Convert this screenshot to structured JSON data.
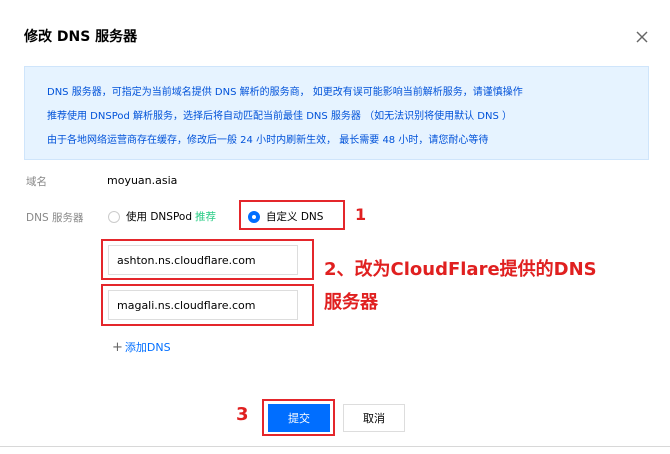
{
  "dialog": {
    "title": "修改 DNS 服务器"
  },
  "notice": {
    "lines": [
      "DNS 服务器，可指定为当前域名提供 DNS 解析的服务商， 如更改有误可能影响当前解析服务，请谨慎操作",
      "推荐使用 DNSPod 解析服务，选择后将自动匹配当前最佳 DNS 服务器 （如无法识别将使用默认 DNS ）",
      "由于各地网络运营商存在缓存，修改后一般 24 小时内刷新生效， 最长需要 48 小时，请您耐心等待"
    ]
  },
  "domain": {
    "label": "域名",
    "value": "moyuan.asia"
  },
  "dns_server": {
    "label": "DNS 服务器",
    "option_dnspod": "使用 DNSPod",
    "option_dnspod_badge": "推荐",
    "option_custom": "自定义 DNS",
    "selected": "custom"
  },
  "inputs": {
    "dns1": "ashton.ns.cloudflare.com",
    "dns2": "magali.ns.cloudflare.com"
  },
  "add_dns_label": "添加DNS",
  "buttons": {
    "submit": "提交",
    "cancel": "取消"
  },
  "annotations": {
    "step1": "1",
    "step2_line1": "2、改为CloudFlare提供的DNS",
    "step2_line2": "服务器",
    "step3": "3"
  },
  "colors": {
    "accent": "#006eff",
    "annotation_red": "#e4262b",
    "recommend_green": "#29cc85",
    "notice_bg": "#e6f3ff",
    "notice_text": "#0052d9"
  }
}
